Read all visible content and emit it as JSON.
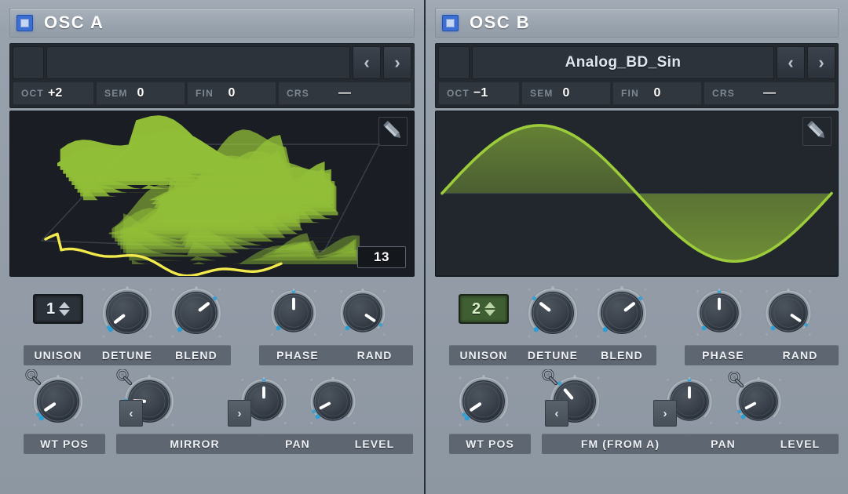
{
  "theme": {
    "background": "#939ca7",
    "panel_header_bg": "#9aa4af",
    "display_bg": "#1a1e24",
    "wave_green": "#9ccc3a",
    "wave_yellow": "#f2ea4c",
    "led_blue": "#3b6fd4",
    "active_green": "#3f5e32",
    "knob_pointer": "#ffffff",
    "knob_dot": "#2e9fd4",
    "label_bar_bg": "#5e6671"
  },
  "oscillators": [
    {
      "id": "osc-a",
      "title": "OSC A",
      "enabled": true,
      "led_name": "power-led",
      "browser": {
        "preset_name": "",
        "prev_label": "‹",
        "next_label": "›"
      },
      "tune": [
        {
          "label": "OCT",
          "value": "+2"
        },
        {
          "label": "SEM",
          "value": "0"
        },
        {
          "label": "FIN",
          "value": "0"
        },
        {
          "label": "CRS",
          "value": "—"
        }
      ],
      "display": {
        "mode": "wavetable-3d",
        "edit_icon": "pencil-icon",
        "wt_index": "13",
        "overlay_wave": "yellow-waveform"
      },
      "unison": {
        "label": "UNISON",
        "value": "1",
        "active": false
      },
      "knobs_top": [
        {
          "name": "detune",
          "label": "DETUNE",
          "angle": -128,
          "has_mod": false
        },
        {
          "name": "blend",
          "label": "BLEND",
          "angle": 52,
          "has_mod": false
        },
        {
          "name": "phase",
          "label": "PHASE",
          "angle": 0,
          "has_mod": false
        },
        {
          "name": "rand",
          "label": "RAND",
          "angle": 124,
          "has_mod": false
        }
      ],
      "knobs_bottom": [
        {
          "name": "wt-pos",
          "label": "WT POS",
          "angle": -124,
          "has_mod": true
        },
        {
          "name": "mirror",
          "label": "MIRROR",
          "angle": -88,
          "has_mod": true
        },
        {
          "name": "pan",
          "label": "PAN",
          "angle": 0,
          "has_mod": false
        },
        {
          "name": "level",
          "label": "LEVEL",
          "angle": -118,
          "has_mod": false
        }
      ],
      "selector": {
        "prev_label": "‹",
        "next_label": "›"
      }
    },
    {
      "id": "osc-b",
      "title": "OSC B",
      "enabled": true,
      "led_name": "power-led",
      "browser": {
        "preset_name": "Analog_BD_Sin",
        "prev_label": "‹",
        "next_label": "›"
      },
      "tune": [
        {
          "label": "OCT",
          "value": "−1"
        },
        {
          "label": "SEM",
          "value": "0"
        },
        {
          "label": "FIN",
          "value": "0"
        },
        {
          "label": "CRS",
          "value": "—"
        }
      ],
      "display": {
        "mode": "sine-wave",
        "edit_icon": "pencil-icon",
        "wt_index": "",
        "overlay_wave": ""
      },
      "unison": {
        "label": "UNISON",
        "value": "2",
        "active": true
      },
      "knobs_top": [
        {
          "name": "detune",
          "label": "DETUNE",
          "angle": -52,
          "has_mod": false
        },
        {
          "name": "blend",
          "label": "BLEND",
          "angle": 52,
          "has_mod": false
        },
        {
          "name": "phase",
          "label": "PHASE",
          "angle": 0,
          "has_mod": false
        },
        {
          "name": "rand",
          "label": "RAND",
          "angle": 124,
          "has_mod": false
        }
      ],
      "knobs_bottom": [
        {
          "name": "wt-pos",
          "label": "WT POS",
          "angle": -124,
          "has_mod": false
        },
        {
          "name": "fm",
          "label": "FM (FROM A)",
          "angle": -40,
          "has_mod": true
        },
        {
          "name": "pan",
          "label": "PAN",
          "angle": 0,
          "has_mod": false
        },
        {
          "name": "level",
          "label": "LEVEL",
          "angle": -118,
          "has_mod": true
        }
      ],
      "selector": {
        "prev_label": "‹",
        "next_label": "›"
      }
    }
  ]
}
